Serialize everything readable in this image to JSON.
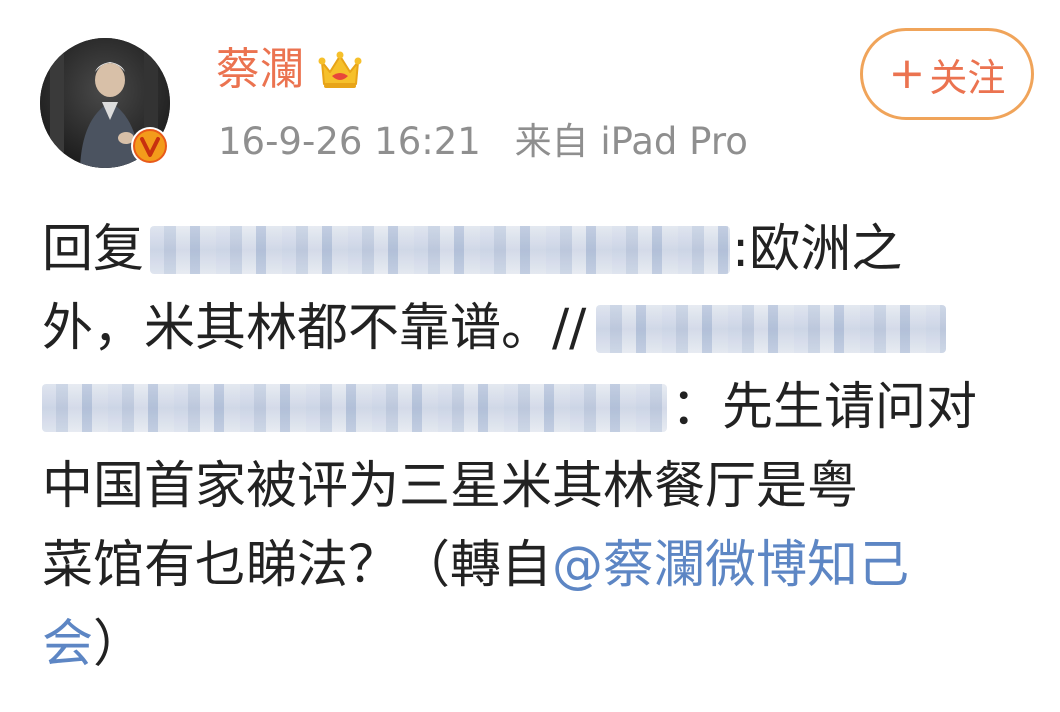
{
  "post": {
    "username": "蔡瀾",
    "timestamp": "16-9-26 16:21",
    "source": "来自 iPad Pro",
    "follow": {
      "plus": "+",
      "label": "关注"
    },
    "body": {
      "line1_prefix": "回复",
      "line1_suffix": ":欧洲之",
      "line2_text": "外，米其林都不靠谱。//",
      "line3_suffix": "：先生请问对",
      "line4_text": "中国首家被评为三星米其林餐厅是粤",
      "line5_text": "菜馆有乜睇法？（轉自",
      "line5_mention": "@蔡瀾微博知己",
      "line6_mention": "会",
      "line6_suffix": "）"
    }
  },
  "icons": {
    "avatar": "profile-photo",
    "verified": "verified-v-badge",
    "crown": "crown-icon"
  },
  "colors": {
    "username": "#eb7350",
    "follow_border": "#f0a45a",
    "meta": "#8f8f8f",
    "text": "#222222",
    "mention": "#5d86c4"
  }
}
